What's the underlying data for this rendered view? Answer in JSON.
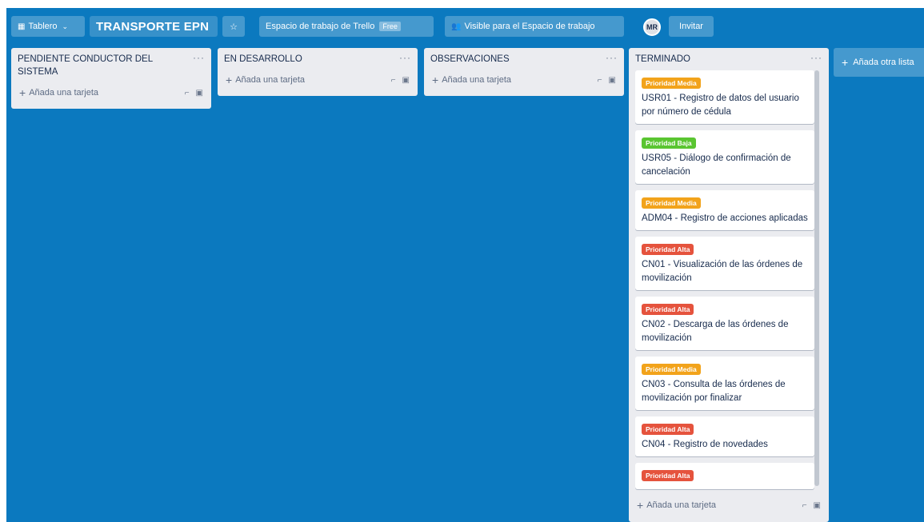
{
  "header": {
    "board_menu_label": "Tablero",
    "board_title": "TRANSPORTE EPN",
    "workspace_label": "Espacio de trabajo de Trello",
    "workspace_badge": "Free",
    "visibility_label": "Visible para el Espacio de trabajo",
    "avatar_initials": "MR",
    "invite_label": "Invitar"
  },
  "add_card_label": "Añada una tarjeta",
  "add_list_label": "Añada otra lista",
  "lists": [
    {
      "title": "PENDIENTE CONDUCTOR DEL SISTEMA"
    },
    {
      "title": "EN DESARROLLO"
    },
    {
      "title": "OBSERVACIONES"
    },
    {
      "title": "TERMINADO",
      "cards": [
        {
          "label": "Prioridad Media",
          "label_color": "#f2a31b",
          "text": "USR01 - Registro de datos del usuario por número de cédula"
        },
        {
          "label": "Prioridad Baja",
          "label_color": "#5ac531",
          "text": "USR05 - Diálogo de confirmación de cancelación"
        },
        {
          "label": "Prioridad Media",
          "label_color": "#f2a31b",
          "text": "ADM04 - Registro de acciones aplicadas"
        },
        {
          "label": "Prioridad Alta",
          "label_color": "#e5533d",
          "text": "CN01 - Visualización de las órdenes de movilización"
        },
        {
          "label": "Prioridad Alta",
          "label_color": "#e5533d",
          "text": "CN02 - Descarga de las órdenes de movilización"
        },
        {
          "label": "Prioridad Media",
          "label_color": "#f2a31b",
          "text": "CN03 - Consulta de las órdenes de movilización por finalizar"
        },
        {
          "label": "Prioridad Alta",
          "label_color": "#e5533d",
          "text": "CN04 - Registro de novedades"
        },
        {
          "label": "Prioridad Alta",
          "label_color": "#e5533d",
          "text": ""
        }
      ]
    }
  ]
}
